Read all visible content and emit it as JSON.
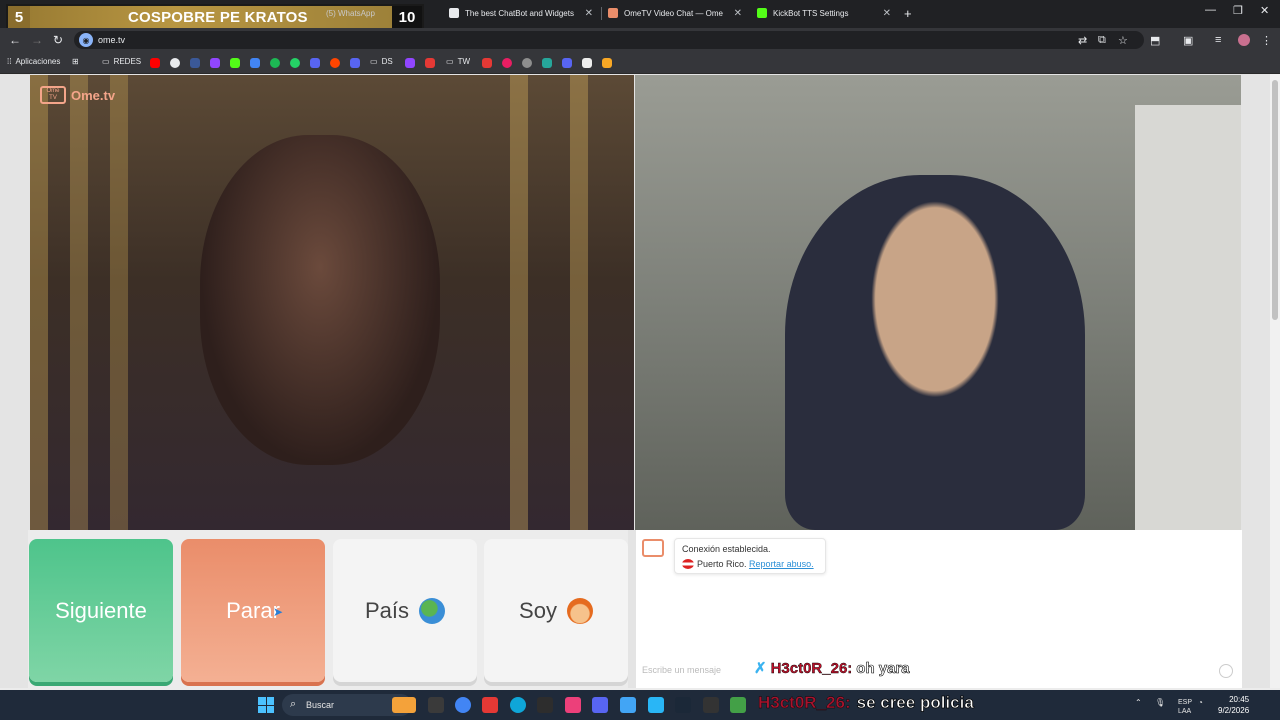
{
  "overlay_score": {
    "left_score": "5",
    "title": "COSPOBRE PE KRATOS",
    "right_score": "10",
    "mini_text": "(5) WhatsApp"
  },
  "tabs": [
    {
      "label": "The best ChatBot and Widgets",
      "fav_color": "#e8eaed"
    },
    {
      "label": "OmeTV Video Chat — Ome",
      "fav_color": "#ea8d6a"
    },
    {
      "label": "KickBot TTS Settings",
      "fav_color": "#53fc18"
    }
  ],
  "address_bar": {
    "url": "ome.tv"
  },
  "bookmarks": {
    "apps_label": "Aplicaciones",
    "redes_label": "REDES",
    "ds_label": "DS",
    "tw_label": "TW"
  },
  "ometv": {
    "logo_small": "Ome TV",
    "logo_text": "Ome.tv",
    "buttons": {
      "next": "Siguiente",
      "stop": "Parar",
      "country": "País",
      "gender": "Soy"
    },
    "chat": {
      "notice_line1": "Conexión establecida.",
      "notice_country": "Puerto Rico.",
      "notice_link": "Reportar abuso.",
      "input_placeholder": "Escribe un mensaje"
    }
  },
  "stream_overlay": {
    "chat_name": "H3ct0R_26:",
    "chat_message": "oh yara",
    "ticker_name": "H3ct0R_26:",
    "ticker_message": "se cree policia"
  },
  "taskbar": {
    "search_label": "Buscar",
    "lang_line1": "ESP",
    "lang_line2": "LAA",
    "time": "20:45",
    "date": "9/2/2026"
  }
}
